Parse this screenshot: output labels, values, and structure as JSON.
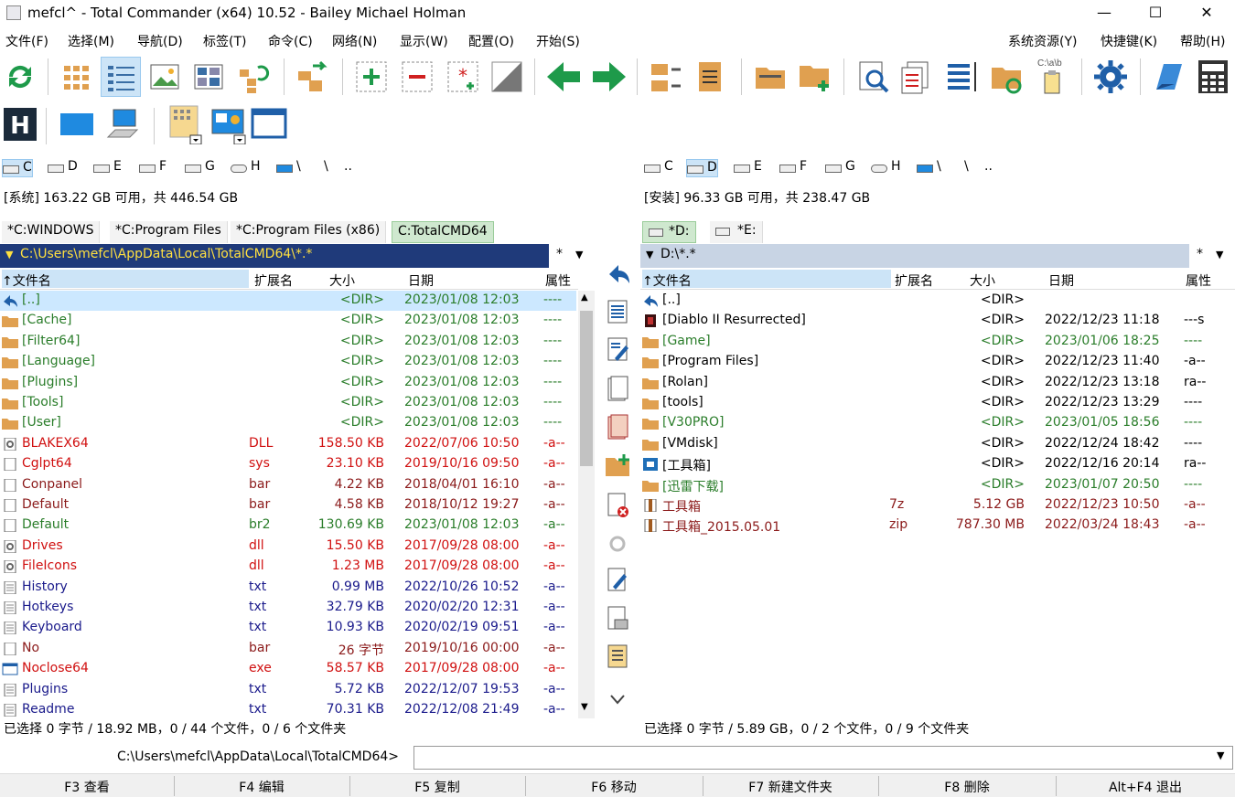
{
  "window": {
    "title": "mefcl^ - Total Commander (x64) 10.52 - Bailey Michael Holman",
    "minimize": "—",
    "maximize": "☐",
    "close": "✕"
  },
  "menu": [
    "文件(F)",
    "选择(M)",
    "导航(D)",
    "标签(T)",
    "命令(C)",
    "网络(N)",
    "显示(W)",
    "配置(O)",
    "开始(S)"
  ],
  "menu_right": [
    "系统资源(Y)",
    "快捷键(K)",
    "帮助(H)"
  ],
  "toolbar": {
    "path_label": "C:\\a\\b",
    "icons": [
      "refresh-icon",
      "brief-view-icon",
      "detailed-view-icon",
      "thumbnail-view-icon",
      "tree-view-icon",
      "tree-refresh-icon",
      "pack-icon",
      "select-group-icon",
      "unselect-group-icon",
      "select-all-icon",
      "invert-selection-icon",
      "back-icon",
      "forward-icon",
      "compare-dirs-icon",
      "sync-dirs-icon",
      "new-folder-icon",
      "add-folder-icon",
      "search-icon",
      "multi-rename-icon",
      "compare-files-icon",
      "folder-sync-icon",
      "copy-path-icon",
      "settings-icon",
      "notepad-icon",
      "calculator-icon"
    ]
  },
  "toolbar2": {
    "icons": [
      "hex-editor-icon",
      "desktop-icon",
      "computer-icon",
      "icons-view-icon",
      "control-panel-icon",
      "window-icon"
    ]
  },
  "drives": [
    "C",
    "D",
    "E",
    "F",
    "G",
    "H",
    "\\",
    "..",
    ""
  ],
  "left": {
    "info": "[系统]  163.22 GB 可用，共 446.54 GB",
    "tabs": [
      "*C:WINDOWS",
      "*C:Program Files",
      "*C:Program Files (x86)",
      "C:TotalCMD64"
    ],
    "path": "C:\\Users\\mefcl\\AppData\\Local\\TotalCMD64\\*.*",
    "path_star": "*",
    "headers": [
      "↑文件名",
      "扩展名",
      "大小",
      "日期",
      "属性"
    ],
    "rows": [
      {
        "name": "[..]",
        "ext": "",
        "size": "<DIR>",
        "date": "2023/01/08 12:03",
        "attr": "----",
        "color": "#2a7d2a",
        "icon": "up"
      },
      {
        "name": "[Cache]",
        "ext": "",
        "size": "<DIR>",
        "date": "2023/01/08 12:03",
        "attr": "----",
        "color": "#2a7d2a",
        "icon": "folder"
      },
      {
        "name": "[Filter64]",
        "ext": "",
        "size": "<DIR>",
        "date": "2023/01/08 12:03",
        "attr": "----",
        "color": "#2a7d2a",
        "icon": "folder"
      },
      {
        "name": "[Language]",
        "ext": "",
        "size": "<DIR>",
        "date": "2023/01/08 12:03",
        "attr": "----",
        "color": "#2a7d2a",
        "icon": "folder"
      },
      {
        "name": "[Plugins]",
        "ext": "",
        "size": "<DIR>",
        "date": "2023/01/08 12:03",
        "attr": "----",
        "color": "#2a7d2a",
        "icon": "folder"
      },
      {
        "name": "[Tools]",
        "ext": "",
        "size": "<DIR>",
        "date": "2023/01/08 12:03",
        "attr": "----",
        "color": "#2a7d2a",
        "icon": "folder"
      },
      {
        "name": "[User]",
        "ext": "",
        "size": "<DIR>",
        "date": "2023/01/08 12:03",
        "attr": "----",
        "color": "#2a7d2a",
        "icon": "folder"
      },
      {
        "name": "BLAKEX64",
        "ext": "DLL",
        "size": "158.50 KB",
        "date": "2022/07/06 10:50",
        "attr": "-a--",
        "color": "#d01010",
        "icon": "gear"
      },
      {
        "name": "Cglpt64",
        "ext": "sys",
        "size": "23.10 KB",
        "date": "2019/10/16 09:50",
        "attr": "-a--",
        "color": "#d01010",
        "icon": "file"
      },
      {
        "name": "Conpanel",
        "ext": "bar",
        "size": "4.22 KB",
        "date": "2018/04/01 16:10",
        "attr": "-a--",
        "color": "#8b1a1a",
        "icon": "file"
      },
      {
        "name": "Default",
        "ext": "bar",
        "size": "4.58 KB",
        "date": "2018/10/12 19:27",
        "attr": "-a--",
        "color": "#8b1a1a",
        "icon": "file"
      },
      {
        "name": "Default",
        "ext": "br2",
        "size": "130.69 KB",
        "date": "2023/01/08 12:03",
        "attr": "-a--",
        "color": "#2a7d2a",
        "icon": "file"
      },
      {
        "name": "Drives",
        "ext": "dll",
        "size": "15.50 KB",
        "date": "2017/09/28 08:00",
        "attr": "-a--",
        "color": "#d01010",
        "icon": "gear"
      },
      {
        "name": "FileIcons",
        "ext": "dll",
        "size": "1.23 MB",
        "date": "2017/09/28 08:00",
        "attr": "-a--",
        "color": "#d01010",
        "icon": "gear"
      },
      {
        "name": "History",
        "ext": "txt",
        "size": "0.99 MB",
        "date": "2022/10/26 10:52",
        "attr": "-a--",
        "color": "#1a1a8b",
        "icon": "text"
      },
      {
        "name": "Hotkeys",
        "ext": "txt",
        "size": "32.79 KB",
        "date": "2020/02/20 12:31",
        "attr": "-a--",
        "color": "#1a1a8b",
        "icon": "text"
      },
      {
        "name": "Keyboard",
        "ext": "txt",
        "size": "10.93 KB",
        "date": "2020/02/19 09:51",
        "attr": "-a--",
        "color": "#1a1a8b",
        "icon": "text"
      },
      {
        "name": "No",
        "ext": "bar",
        "size": "26 字节",
        "date": "2019/10/16 00:00",
        "attr": "-a--",
        "color": "#8b1a1a",
        "icon": "file"
      },
      {
        "name": "Noclose64",
        "ext": "exe",
        "size": "58.57 KB",
        "date": "2017/09/28 08:00",
        "attr": "-a--",
        "color": "#d01010",
        "icon": "exe"
      },
      {
        "name": "Plugins",
        "ext": "txt",
        "size": "5.72 KB",
        "date": "2022/12/07 19:53",
        "attr": "-a--",
        "color": "#1a1a8b",
        "icon": "text"
      },
      {
        "name": "Readme",
        "ext": "txt",
        "size": "70.31 KB",
        "date": "2022/12/08 21:49",
        "attr": "-a--",
        "color": "#1a1a8b",
        "icon": "text"
      }
    ],
    "status": "已选择 0 字节 / 18.92 MB，0 / 44 个文件，0 / 6 个文件夹"
  },
  "right": {
    "info": "[安装]  96.33 GB 可用，共 238.47 GB",
    "tabs": [
      "*D:",
      "*E:"
    ],
    "path": "D:\\*.*",
    "path_star": "*",
    "headers": [
      "↑文件名",
      "扩展名",
      "大小",
      "日期",
      "属性"
    ],
    "rows": [
      {
        "name": "[..]",
        "ext": "",
        "size": "<DIR>",
        "date": "",
        "attr": "",
        "color": "#000",
        "icon": "up"
      },
      {
        "name": "[Diablo II Resurrected]",
        "ext": "",
        "size": "<DIR>",
        "date": "2022/12/23 11:18",
        "attr": "---s",
        "color": "#000",
        "icon": "game"
      },
      {
        "name": "[Game]",
        "ext": "",
        "size": "<DIR>",
        "date": "2023/01/06 18:25",
        "attr": "----",
        "color": "#2a7d2a",
        "icon": "folder"
      },
      {
        "name": "[Program Files]",
        "ext": "",
        "size": "<DIR>",
        "date": "2022/12/23 11:40",
        "attr": "-a--",
        "color": "#000",
        "icon": "folder"
      },
      {
        "name": "[Rolan]",
        "ext": "",
        "size": "<DIR>",
        "date": "2022/12/23 13:18",
        "attr": "ra--",
        "color": "#000",
        "icon": "folder"
      },
      {
        "name": "[tools]",
        "ext": "",
        "size": "<DIR>",
        "date": "2022/12/23 13:29",
        "attr": "----",
        "color": "#000",
        "icon": "folder"
      },
      {
        "name": "[V30PRO]",
        "ext": "",
        "size": "<DIR>",
        "date": "2023/01/05 18:56",
        "attr": "----",
        "color": "#2a7d2a",
        "icon": "folder"
      },
      {
        "name": "[VMdisk]",
        "ext": "",
        "size": "<DIR>",
        "date": "2022/12/24 18:42",
        "attr": "----",
        "color": "#000",
        "icon": "folder"
      },
      {
        "name": "[工具箱]",
        "ext": "",
        "size": "<DIR>",
        "date": "2022/12/16 20:14",
        "attr": "ra--",
        "color": "#000",
        "icon": "toolbox"
      },
      {
        "name": "[迅雷下载]",
        "ext": "",
        "size": "<DIR>",
        "date": "2023/01/07 20:50",
        "attr": "----",
        "color": "#2a7d2a",
        "icon": "folder"
      },
      {
        "name": "工具箱",
        "ext": "7z",
        "size": "5.12 GB",
        "date": "2022/12/23 10:50",
        "attr": "-a--",
        "color": "#8b1a1a",
        "icon": "archive"
      },
      {
        "name": "工具箱_2015.05.01",
        "ext": "zip",
        "size": "787.30 MB",
        "date": "2022/03/24 18:43",
        "attr": "-a--",
        "color": "#8b1a1a",
        "icon": "archive"
      }
    ],
    "status": "已选择 0 字节 / 5.89 GB，0 / 2 个文件，0 / 9 个文件夹"
  },
  "middle_icons": [
    "up-dir-icon",
    "view-file-icon",
    "edit-file-icon",
    "copy-file-icon",
    "move-file-icon",
    "new-folder-icon",
    "delete-icon",
    "properties-icon",
    "edit-text-icon",
    "print-icon",
    "list-icon",
    "more-icon"
  ],
  "cmdline": {
    "prompt": "C:\\Users\\mefcl\\AppData\\Local\\TotalCMD64>",
    "value": ""
  },
  "fkeys": [
    "F3 查看",
    "F4 编辑",
    "F5 复制",
    "F6 移动",
    "F7 新建文件夹",
    "F8 删除",
    "Alt+F4 退出"
  ]
}
